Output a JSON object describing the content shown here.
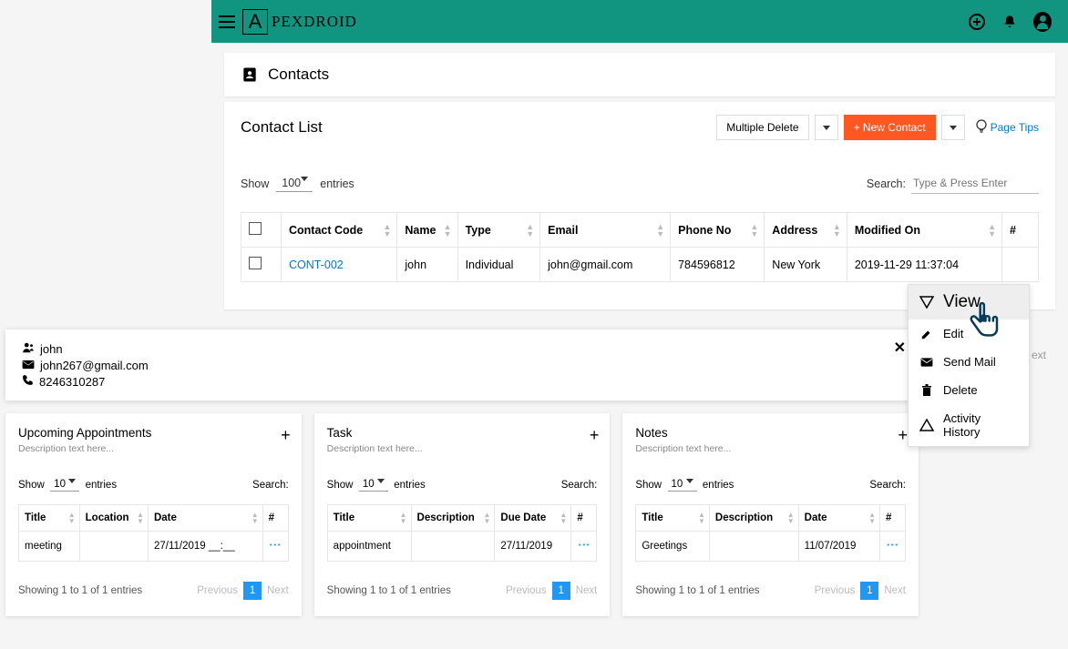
{
  "brand": {
    "letter": "A",
    "name": "PEXDROID"
  },
  "page": {
    "title": "Contacts"
  },
  "list": {
    "title": "Contact List",
    "multi_delete": "Multiple Delete",
    "new_contact": "+ New Contact",
    "page_tips": "Page Tips",
    "show_label": "Show",
    "show_value": "100",
    "entries_label": "entries",
    "search_label": "Search:",
    "search_placeholder": "Type & Press Enter",
    "cols": {
      "code": "Contact Code",
      "name": "Name",
      "type": "Type",
      "email": "Email",
      "phone": "Phone No",
      "address": "Address",
      "modified": "Modified On",
      "hash": "#"
    },
    "row": {
      "code": "CONT-002",
      "name": "john",
      "type": "Individual",
      "email": "john@gmail.com",
      "phone": "784596812",
      "address": "New York",
      "modified": "2019-11-29 11:37:04"
    },
    "next_ghost": "ext"
  },
  "ctx": {
    "view": "View",
    "edit": "Edit",
    "send": "Send Mail",
    "delete": "Delete",
    "history": "Activity History"
  },
  "detail": {
    "name": "john",
    "email": "john267@gmail.com",
    "phone": "8246310287"
  },
  "widgets": {
    "desc": "Description text here...",
    "show_label": "Show",
    "show_value": "10",
    "entries_label": "entries",
    "search_label": "Search:",
    "hash": "#",
    "prev": "Previous",
    "next": "Next",
    "page": "1",
    "pager_info": "Showing 1 to 1 of 1 entries",
    "appt": {
      "title": "Upcoming Appointments",
      "cols": {
        "title": "Title",
        "location": "Location",
        "date": "Date"
      },
      "row": {
        "title": "meeting",
        "location": "",
        "date": "27/11/2019 __:__"
      }
    },
    "task": {
      "title": "Task",
      "cols": {
        "title": "Title",
        "desc": "Description",
        "due": "Due Date"
      },
      "row": {
        "title": "appointment",
        "desc": "",
        "due": "27/11/2019"
      }
    },
    "notes": {
      "title": "Notes",
      "cols": {
        "title": "Title",
        "desc": "Description",
        "date": "Date"
      },
      "row": {
        "title": "Greetings",
        "desc": "",
        "date": "11/07/2019"
      }
    }
  }
}
